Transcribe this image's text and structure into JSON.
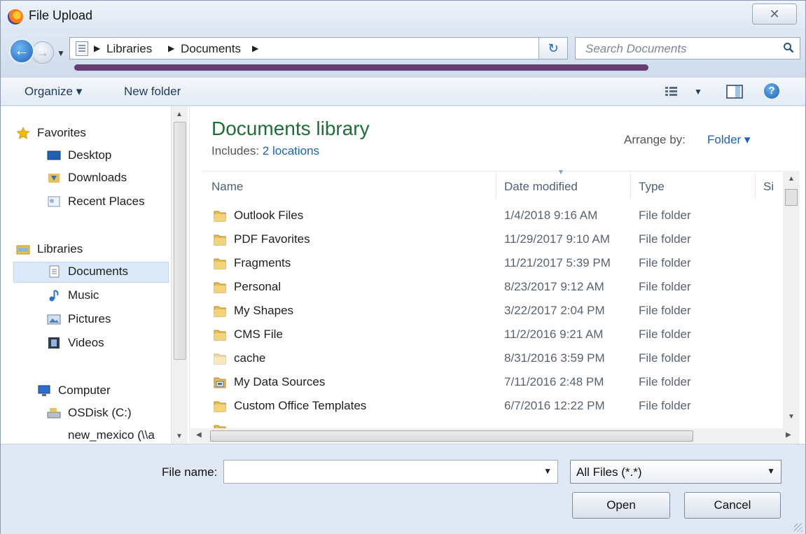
{
  "window": {
    "title": "File Upload",
    "close_glyph": "✕"
  },
  "navbar": {
    "breadcrumbs": [
      "Libraries",
      "Documents"
    ],
    "search_placeholder": "Search Documents"
  },
  "toolbar": {
    "organize": "Organize ▾",
    "new_folder": "New folder"
  },
  "nav_pane": {
    "favorites": {
      "label": "Favorites",
      "items": [
        "Desktop",
        "Downloads",
        "Recent Places"
      ]
    },
    "libraries": {
      "label": "Libraries",
      "items": [
        "Documents",
        "Music",
        "Pictures",
        "Videos"
      ],
      "selected": "Documents"
    },
    "computer": {
      "label": "Computer",
      "items": [
        "OSDisk (C:)",
        "new_mexico (\\\\a"
      ]
    }
  },
  "library": {
    "title": "Documents library",
    "includes_label": "Includes:",
    "includes_link": "2 locations",
    "arrange_label": "Arrange by:",
    "arrange_value": "Folder ▾"
  },
  "columns": {
    "name": "Name",
    "date": "Date modified",
    "type": "Type",
    "size": "Si"
  },
  "files": [
    {
      "name": "Outlook Files",
      "date": "1/4/2018 9:16 AM",
      "type": "File folder",
      "icon": "folder-icon"
    },
    {
      "name": "PDF Favorites",
      "date": "11/29/2017 9:10 AM",
      "type": "File folder",
      "icon": "folder-icon"
    },
    {
      "name": "Fragments",
      "date": "11/21/2017 5:39 PM",
      "type": "File folder",
      "icon": "folder-icon"
    },
    {
      "name": "Personal",
      "date": "8/23/2017 9:12 AM",
      "type": "File folder",
      "icon": "folder-icon"
    },
    {
      "name": "My Shapes",
      "date": "3/22/2017 2:04 PM",
      "type": "File folder",
      "icon": "folder-icon"
    },
    {
      "name": "CMS File",
      "date": "11/2/2016 9:21 AM",
      "type": "File folder",
      "icon": "folder-icon"
    },
    {
      "name": "cache",
      "date": "8/31/2016 3:59 PM",
      "type": "File folder",
      "icon": "folder-icon"
    },
    {
      "name": "My Data Sources",
      "date": "7/11/2016 2:48 PM",
      "type": "File folder",
      "icon": "data-source-folder-icon"
    },
    {
      "name": "Custom Office Templates",
      "date": "6/7/2016 12:22 PM",
      "type": "File folder",
      "icon": "folder-icon"
    }
  ],
  "footer": {
    "file_name_label": "File name:",
    "file_name_value": "",
    "file_type": "All Files (*.*)",
    "open": "Open",
    "cancel": "Cancel"
  }
}
